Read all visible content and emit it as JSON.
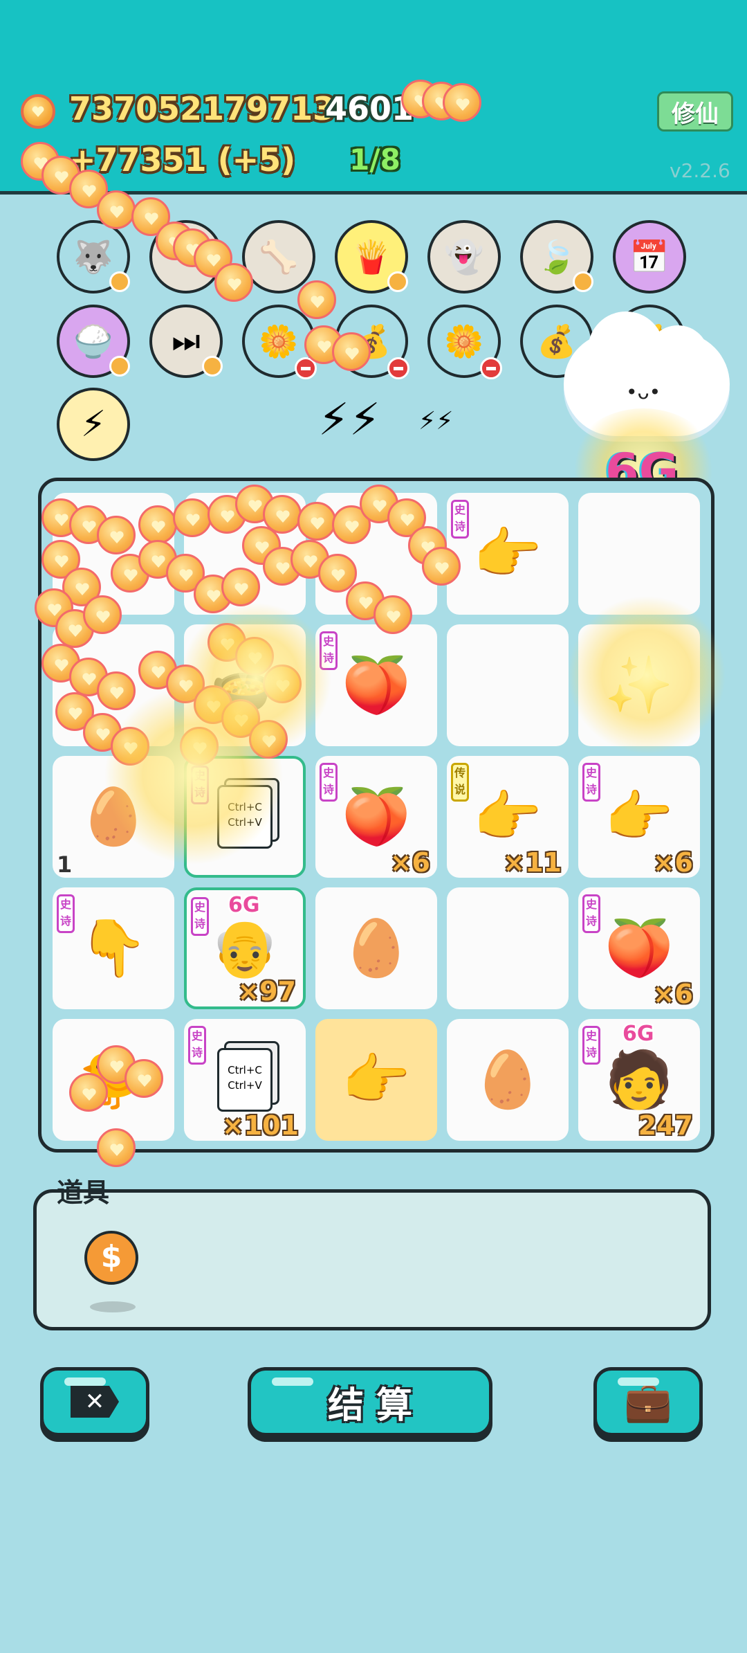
{
  "header": {
    "coins": "737052179713",
    "coin_rate": "+77351 (+5)",
    "score": "4601",
    "round": "1/8",
    "mode_button": "修仙",
    "version": "v2.2.6"
  },
  "bonus_label": "6G",
  "relics": [
    {
      "icon": "husky-icon",
      "emoji": "🐺",
      "bg": "#a9dde6"
    },
    {
      "icon": "blank-relic-icon",
      "emoji": "",
      "bg": "#e8e2d6"
    },
    {
      "icon": "dog-bowl-icon",
      "emoji": "🦴",
      "bg": "#e8e2d6"
    },
    {
      "icon": "fries-icon",
      "emoji": "🍟",
      "bg": "#fff07a"
    },
    {
      "icon": "ghost-icon",
      "emoji": "👻",
      "bg": "#e8e2d6"
    },
    {
      "icon": "leaf-icon",
      "emoji": "🍃",
      "bg": "#e8e2d6"
    },
    {
      "icon": "calendar-icon",
      "emoji": "📅",
      "bg": "#d9a6ef"
    },
    {
      "icon": "rice-bowl-icon",
      "emoji": "🍚",
      "bg": "#d9a6ef"
    },
    {
      "icon": "skip-icon",
      "emoji": "⏭",
      "bg": "#e8e2d6"
    },
    {
      "icon": "flower-pot-icon",
      "emoji": "🌼",
      "bg": "#a9dde6"
    },
    {
      "icon": "sack-icon",
      "emoji": "💰",
      "bg": "#a9dde6"
    },
    {
      "icon": "flower-pot-icon",
      "emoji": "🌼",
      "bg": "#a9dde6"
    },
    {
      "icon": "sack-icon",
      "emoji": "💰",
      "bg": "#a9dde6"
    },
    {
      "icon": "sack-icon",
      "emoji": "💰",
      "bg": "#a9dde6"
    }
  ],
  "rarity": {
    "epic": "史诗",
    "legendary": "传说"
  },
  "board": [
    {
      "icon": "coin-pile-icon",
      "emoji": "",
      "rarity": "",
      "count": ""
    },
    {
      "icon": "coin-pile-icon",
      "emoji": "",
      "rarity": "",
      "count": ""
    },
    {
      "icon": "coin-pile-icon",
      "emoji": "",
      "rarity": "",
      "count": ""
    },
    {
      "icon": "pointing-hand-icon",
      "emoji": "👉",
      "rarity": "epic",
      "count": ""
    },
    {
      "icon": "empty-cell",
      "emoji": "",
      "rarity": "",
      "count": ""
    },
    {
      "icon": "coin-pile-icon",
      "emoji": "",
      "rarity": "",
      "count": ""
    },
    {
      "icon": "pot-icon",
      "emoji": "🍲",
      "rarity": "",
      "count": ""
    },
    {
      "icon": "peach-icon",
      "emoji": "🍑",
      "rarity": "epic",
      "count": ""
    },
    {
      "icon": "empty-cell",
      "emoji": "",
      "rarity": "",
      "count": ""
    },
    {
      "icon": "sparkle-cell",
      "emoji": "✨",
      "rarity": "",
      "count": ""
    },
    {
      "icon": "egg-icon",
      "emoji": "🥚",
      "rarity": "",
      "count": "1"
    },
    {
      "icon": "copy-paste-icon",
      "emoji": "📄",
      "rarity": "epic",
      "count": ""
    },
    {
      "icon": "peach-icon",
      "emoji": "🍑",
      "rarity": "epic",
      "count": "×6"
    },
    {
      "icon": "golden-hand-icon",
      "emoji": "👉",
      "rarity": "legendary",
      "count": "×11"
    },
    {
      "icon": "pointing-hand-icon",
      "emoji": "👉",
      "rarity": "epic",
      "count": "×6"
    },
    {
      "icon": "pointing-down-hand-icon",
      "emoji": "👇",
      "rarity": "epic",
      "count": ""
    },
    {
      "icon": "old-man-face-icon",
      "emoji": "👴",
      "rarity": "epic",
      "count": "×97",
      "tag": "6G"
    },
    {
      "icon": "egg-icon",
      "emoji": "🥚",
      "rarity": "",
      "count": ""
    },
    {
      "icon": "empty-cell",
      "emoji": "",
      "rarity": "",
      "count": ""
    },
    {
      "icon": "peach-icon",
      "emoji": "🍑",
      "rarity": "epic",
      "count": "×6"
    },
    {
      "icon": "chick-icon",
      "emoji": "🐤",
      "rarity": "",
      "count": ""
    },
    {
      "icon": "copy-paste-icon",
      "emoji": "📄",
      "rarity": "epic",
      "count": "×101"
    },
    {
      "icon": "golden-hand-icon",
      "emoji": "👉",
      "rarity": "",
      "count": ""
    },
    {
      "icon": "egg-icon",
      "emoji": "🥚",
      "rarity": "",
      "count": ""
    },
    {
      "icon": "lady-face-icon",
      "emoji": "🧑",
      "rarity": "epic",
      "count": "247",
      "tag": "6G"
    }
  ],
  "copy_paste_text": {
    "line1": "Ctrl+C",
    "line2": "Ctrl+V"
  },
  "items": {
    "label": "道具"
  },
  "buttons": {
    "settle": "结 算"
  },
  "colors": {
    "header": "#17c2c3",
    "accent": "#22c5c3",
    "epic": "#c843c6",
    "legendary": "#c9a600",
    "count": "#f6b241"
  }
}
